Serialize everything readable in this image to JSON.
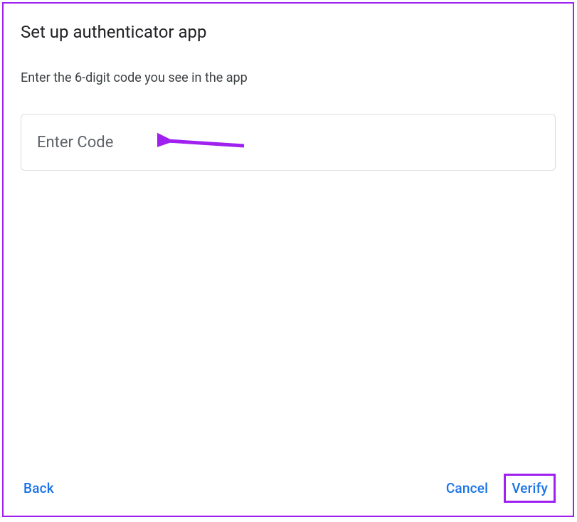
{
  "dialog": {
    "title": "Set up authenticator app",
    "instruction": "Enter the 6-digit code you see in the app"
  },
  "input": {
    "placeholder": "Enter Code",
    "value": ""
  },
  "buttons": {
    "back": "Back",
    "cancel": "Cancel",
    "verify": "Verify"
  },
  "annotations": {
    "arrow_color": "#a020f0",
    "highlight_color": "#a020f0"
  }
}
